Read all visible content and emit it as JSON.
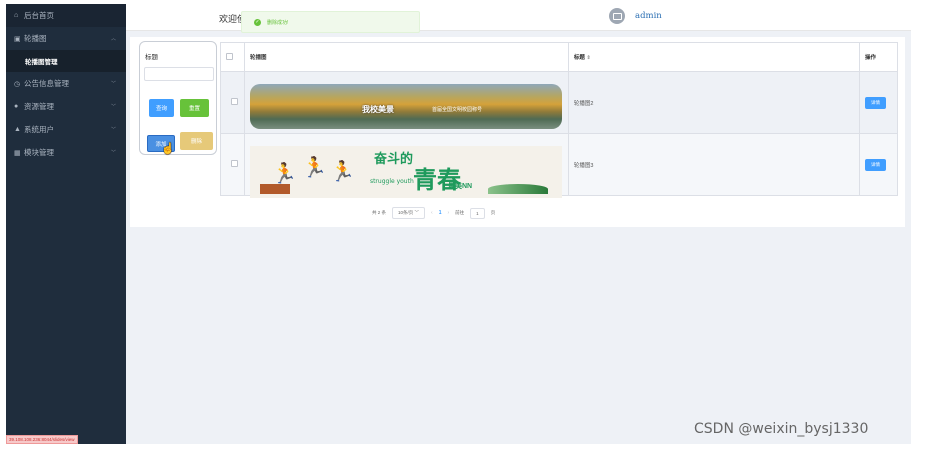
{
  "sidebar": {
    "home": "后台首页",
    "items": [
      {
        "label": "轮播图",
        "icon": "image-icon"
      },
      {
        "label": "轮播图管理",
        "icon": ""
      },
      {
        "label": "公告信息管理",
        "icon": "clock-icon"
      },
      {
        "label": "资源管理",
        "icon": "pin-icon"
      },
      {
        "label": "系统用户",
        "icon": "user-icon"
      },
      {
        "label": "模块管理",
        "icon": "grid-icon"
      }
    ],
    "status_url": "39.108.108.236:8044/slides/view"
  },
  "header": {
    "title": "欢迎使用校园二手交易平台",
    "user": "admin"
  },
  "toast": {
    "text": "删除成功!"
  },
  "search": {
    "label": "标题",
    "input_value": "",
    "query_label": "查询",
    "reset_label": "重置",
    "add_label": "添加",
    "delete_label": "删除"
  },
  "table": {
    "headers": [
      "轮播图",
      "标题",
      "操作"
    ],
    "sort_icon": "⇕",
    "rows": [
      {
        "title": "轮播图2",
        "detail": "详情",
        "banner_text": "我校美景",
        "banner_sub": "首届全国文明校园称号"
      },
      {
        "title": "轮播图3",
        "detail": "详情",
        "banner_big1": "奋斗的",
        "banner_big2": "青春",
        "banner_small": "struggle youth",
        "banner_tag": "最美NN"
      }
    ]
  },
  "pagination": {
    "total": "共 2 条",
    "page_size": "10条/页",
    "current": "1",
    "goto_label": "前往",
    "goto_value": "1",
    "page_unit": "页"
  },
  "watermark": "CSDN @weixin_bysj1330",
  "colors": {
    "sidebar": "#1f2d3d",
    "primary": "#409eff",
    "success": "#67c23a",
    "warning": "#e6c979"
  }
}
